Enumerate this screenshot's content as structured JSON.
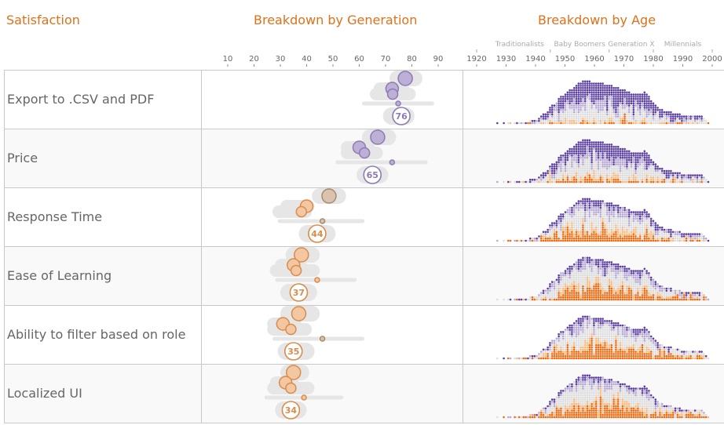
{
  "headers": {
    "satisfaction": "Satisfaction",
    "generation": "Breakdown by Generation",
    "age": "Breakdown by Age"
  },
  "colors": {
    "accent": "#e0701a",
    "high": "#5b3fa0",
    "high_light": "#b6a8d6",
    "neutral": "#dddddd",
    "low_light": "#fdb97a",
    "low": "#f06a10"
  },
  "chart_data": [
    {
      "type": "scatter",
      "title": "Breakdown by Generation",
      "xlim": [
        0,
        100
      ],
      "xticks": [
        10,
        20,
        30,
        40,
        50,
        60,
        70,
        80,
        90
      ],
      "rows": [
        {
          "label": "Export to .CSV and PDF",
          "overall": 76,
          "overall_range": [
            69,
            81
          ],
          "groups": [
            {
              "value": 77.5,
              "range": [
                71.5,
                84
              ]
            },
            {
              "value": 72.5,
              "range": [
                65.5,
                79
              ]
            },
            {
              "value": 72.7,
              "range": [
                64,
                81.5
              ]
            },
            {
              "value": 74.8,
              "range": [
                61,
                88.5
              ]
            }
          ]
        },
        {
          "label": "Price",
          "overall": 65,
          "overall_range": [
            59,
            71
          ],
          "groups": [
            {
              "value": 67,
              "range": [
                61,
                74
              ]
            },
            {
              "value": 60,
              "range": [
                53,
                66
              ]
            },
            {
              "value": 62,
              "range": [
                53,
                69
              ]
            },
            {
              "value": 72.5,
              "range": [
                51,
                86
              ]
            }
          ]
        },
        {
          "label": "Response Time",
          "overall": 44,
          "overall_range": [
            37,
            51
          ],
          "groups": [
            {
              "value": 48.5,
              "range": [
                42,
                55
              ]
            },
            {
              "value": 40,
              "range": [
                30,
                43
              ]
            },
            {
              "value": 38,
              "range": [
                27,
                42
              ]
            },
            {
              "value": 46,
              "range": [
                29,
                62
              ]
            }
          ]
        },
        {
          "label": "Ease of Learning",
          "overall": 37,
          "overall_range": [
            30,
            44
          ],
          "groups": [
            {
              "value": 38,
              "range": [
                32,
                45
              ]
            },
            {
              "value": 35,
              "range": [
                28,
                40
              ]
            },
            {
              "value": 36,
              "range": [
                26,
                45
              ]
            },
            {
              "value": 44,
              "range": [
                28,
                59
              ]
            }
          ]
        },
        {
          "label": "Ability to filter based on role",
          "overall": 35,
          "overall_range": [
            29,
            43
          ],
          "groups": [
            {
              "value": 37,
              "range": [
                30,
                45
              ]
            },
            {
              "value": 31,
              "range": [
                25,
                38
              ]
            },
            {
              "value": 34,
              "range": [
                25,
                42
              ]
            },
            {
              "value": 46,
              "range": [
                27,
                62
              ]
            }
          ]
        },
        {
          "label": "Localized UI",
          "overall": 34,
          "overall_range": [
            28,
            40
          ],
          "groups": [
            {
              "value": 35,
              "range": [
                30,
                41
              ]
            },
            {
              "value": 32,
              "range": [
                26,
                37
              ]
            },
            {
              "value": 34,
              "range": [
                25,
                43
              ]
            },
            {
              "value": 39,
              "range": [
                24,
                54
              ]
            }
          ]
        }
      ]
    },
    {
      "type": "scatter",
      "title": "Breakdown by Age",
      "xlim": [
        1920,
        2000
      ],
      "xticks": [
        1920,
        1930,
        1940,
        1950,
        1960,
        1970,
        1980,
        1990,
        2000
      ],
      "generations": [
        {
          "name": "Traditionalists",
          "from": 1920,
          "to": 1945
        },
        {
          "name": "Baby Boomers",
          "from": 1945,
          "to": 1965
        },
        {
          "name": "Generation X",
          "from": 1965,
          "to": 1980
        },
        {
          "name": "Millennials",
          "from": 1980,
          "to": 2000
        }
      ],
      "birth_year_counts": {
        "years_from": 1927,
        "counts": [
          1,
          0,
          1,
          0,
          1,
          0,
          1,
          1,
          1,
          1,
          1,
          2,
          2,
          2,
          3,
          4,
          5,
          6,
          8,
          9,
          10,
          12,
          13,
          14,
          15,
          16,
          17,
          18,
          19,
          20,
          20,
          20,
          19,
          19,
          19,
          19,
          19,
          18,
          18,
          18,
          17,
          17,
          16,
          16,
          15,
          15,
          14,
          14,
          14,
          14,
          15,
          14,
          12,
          10,
          9,
          7,
          7,
          6,
          6,
          6,
          5,
          5,
          5,
          4,
          4,
          4,
          4,
          4,
          4,
          4,
          3,
          2,
          1
        ]
      }
    }
  ]
}
